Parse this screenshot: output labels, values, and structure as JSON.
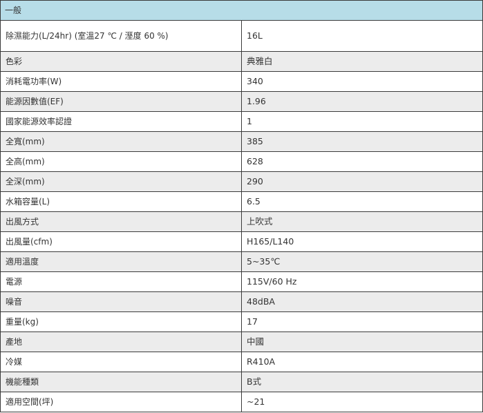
{
  "section_title": "一般",
  "rows": [
    {
      "label": "除濕能力(L/24hr) (室溫27 ℃ / 溼度 60 %)",
      "value": "16L"
    },
    {
      "label": "色彩",
      "value": "典雅白"
    },
    {
      "label": "消耗電功率(W)",
      "value": "340"
    },
    {
      "label": "能源因數值(EF)",
      "value": "1.96"
    },
    {
      "label": "國家能源效率認證",
      "value": "1"
    },
    {
      "label": "全寬(mm)",
      "value": "385"
    },
    {
      "label": "全高(mm)",
      "value": "628"
    },
    {
      "label": "全深(mm)",
      "value": "290"
    },
    {
      "label": "水箱容量(L)",
      "value": "6.5"
    },
    {
      "label": "出風方式",
      "value": "上吹式"
    },
    {
      "label": "出風量(cfm)",
      "value": "H165/L140"
    },
    {
      "label": "適用溫度",
      "value": "5~35℃"
    },
    {
      "label": "電源",
      "value": "115V/60 Hz"
    },
    {
      "label": "噪音",
      "value": "48dBA"
    },
    {
      "label": "重量(kg)",
      "value": "17"
    },
    {
      "label": "產地",
      "value": "中國"
    },
    {
      "label": "冷媒",
      "value": "R410A"
    },
    {
      "label": "機能種類",
      "value": "B式"
    },
    {
      "label": "適用空間(坪)",
      "value": "~21"
    }
  ]
}
